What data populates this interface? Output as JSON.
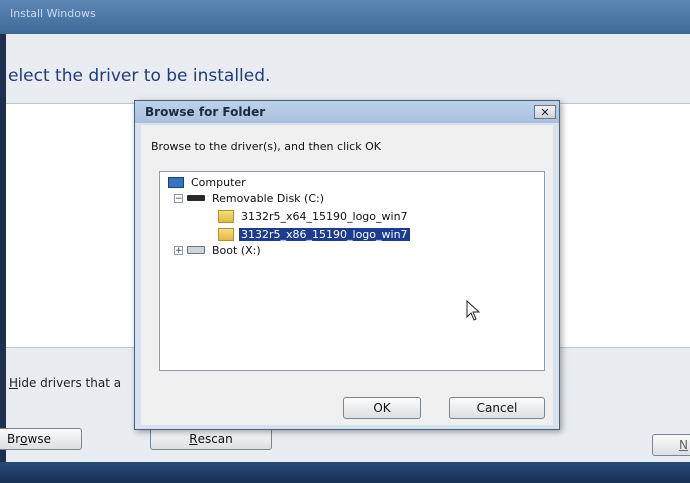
{
  "installer": {
    "title": "Install Windows",
    "heading": "elect the driver to be installed.",
    "hide_drivers_label": "Hide drivers that a",
    "hide_drivers_prefix": "H",
    "hide_drivers_rest": "ide drivers that a",
    "browse_label_a": "Br",
    "browse_label_o": "o",
    "browse_label_b": "wse",
    "rescan_prefix": "R",
    "rescan_rest": "escan",
    "next_label": "N"
  },
  "dialog": {
    "title": "Browse for Folder",
    "close_label": "✕",
    "instruction": "Browse to the driver(s), and then click OK",
    "tree": [
      {
        "label": "Computer",
        "icon": "computer-icon",
        "level": 0
      },
      {
        "label": "Removable Disk (C:)",
        "icon": "removable-disk-icon",
        "level": 1,
        "expander": "−"
      },
      {
        "label": "3132r5_x64_15190_logo_win7",
        "icon": "folder-icon",
        "level": 2
      },
      {
        "label": "3132r5_x86_15190_logo_win7",
        "icon": "folder-icon",
        "level": 2,
        "selected": true
      },
      {
        "label": "Boot (X:)",
        "icon": "boot-drive-icon",
        "level": 1,
        "expander": "+"
      }
    ],
    "ok_label": "OK",
    "cancel_label": "Cancel"
  },
  "colors": {
    "selection": "#1b3c8f",
    "heading": "#1e3c78"
  }
}
